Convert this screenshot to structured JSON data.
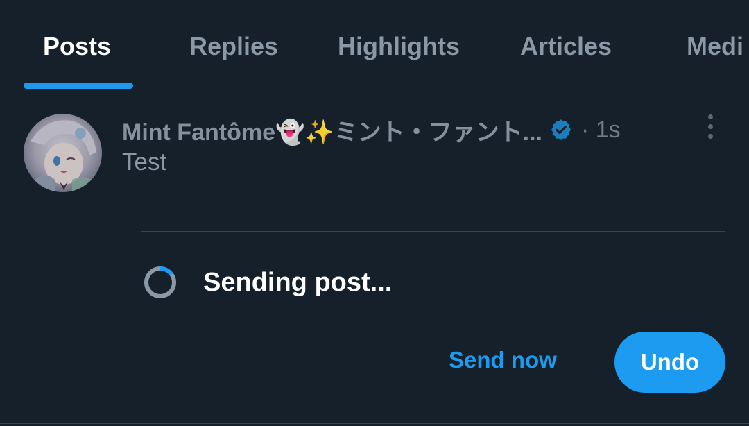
{
  "tabs": [
    {
      "label": "Posts",
      "active": true
    },
    {
      "label": "Replies",
      "active": false
    },
    {
      "label": "Highlights",
      "active": false
    },
    {
      "label": "Articles",
      "active": false
    },
    {
      "label": "Medi",
      "active": false
    }
  ],
  "post": {
    "display_name": "Mint Fantôme👻✨ミント・ファント...",
    "verified": true,
    "time": "· 1s",
    "text": "Test"
  },
  "status": {
    "sending_text": "Sending post...",
    "progress": 0.15
  },
  "actions": {
    "send_now_label": "Send now",
    "undo_label": "Undo"
  },
  "colors": {
    "background": "#15202b",
    "accent": "#1d9bf0",
    "muted_text": "#8b98a5",
    "border": "#38444d"
  }
}
